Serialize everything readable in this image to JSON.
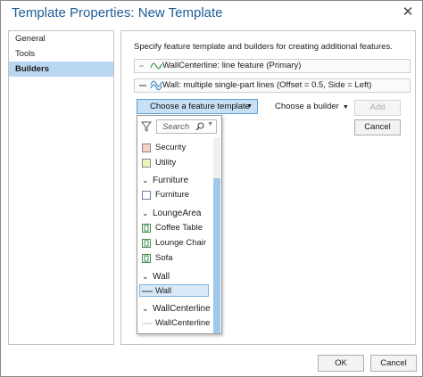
{
  "window": {
    "title": "Template Properties: New Template",
    "close_glyph": "✕"
  },
  "nav": {
    "items": [
      {
        "label": "General"
      },
      {
        "label": "Tools"
      },
      {
        "label": "Builders",
        "selected": true
      }
    ]
  },
  "panel": {
    "description": "Specify feature template and builders for creating additional features.",
    "templates": [
      {
        "label": "WallCenterline: line feature (Primary)",
        "icon": "line-feature-icon"
      },
      {
        "label": "Wall: multiple single-part lines (Offset = 0.5, Side = Left)",
        "icon": "multi-line-icon"
      }
    ],
    "choose_template_label": "Choose a feature template",
    "choose_builder_label": "Choose a builder",
    "add_label": "Add",
    "cancel_label": "Cancel"
  },
  "dropdown": {
    "search_placeholder": "Search",
    "items": [
      {
        "kind": "item",
        "label": "Security",
        "swatch": "#f7cfc4"
      },
      {
        "kind": "item",
        "label": "Utility",
        "swatch": "#eaf7b8"
      },
      {
        "kind": "group",
        "label": "Furniture"
      },
      {
        "kind": "item",
        "label": "Furniture",
        "swatch": "#ffffff"
      },
      {
        "kind": "group",
        "label": "LoungeArea"
      },
      {
        "kind": "item",
        "label": "Coffee Table",
        "icon": "feature-point-icon"
      },
      {
        "kind": "item",
        "label": "Lounge Chair",
        "icon": "feature-point-icon"
      },
      {
        "kind": "item",
        "label": "Sofa",
        "icon": "feature-point-icon"
      },
      {
        "kind": "group",
        "label": "Wall"
      },
      {
        "kind": "item",
        "label": "Wall",
        "icon": "line-icon",
        "selected": true
      },
      {
        "kind": "group",
        "label": "WallCenterline"
      },
      {
        "kind": "item",
        "label": "WallCenterline",
        "icon": "line-icon"
      }
    ]
  },
  "footer": {
    "ok_label": "OK",
    "cancel_label": "Cancel"
  },
  "colors": {
    "accent": "#5aa0d8",
    "selection": "#b9d7f1",
    "title": "#1f5c96"
  }
}
